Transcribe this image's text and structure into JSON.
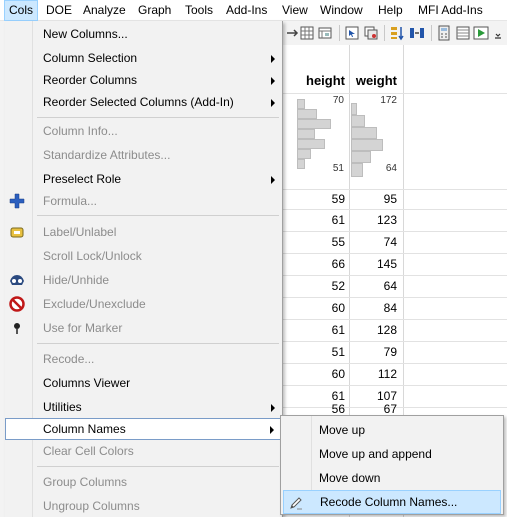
{
  "menubar": {
    "items": [
      "Cols",
      "DOE",
      "Analyze",
      "Graph",
      "Tools",
      "Add-Ins",
      "View",
      "Window",
      "Help",
      "MFI Add-Ins"
    ]
  },
  "cols_menu": {
    "items": [
      {
        "label": "New Columns...",
        "enabled": true,
        "submenu": false,
        "icon": null
      },
      {
        "label": "Column Selection",
        "enabled": true,
        "submenu": true,
        "icon": null
      },
      {
        "label": "Reorder Columns",
        "enabled": true,
        "submenu": true,
        "icon": null
      },
      {
        "label": "Reorder Selected Columns (Add-In)",
        "enabled": true,
        "submenu": true,
        "icon": null
      },
      {
        "label": "Column Info...",
        "enabled": false,
        "submenu": false,
        "icon": null
      },
      {
        "label": "Standardize Attributes...",
        "enabled": false,
        "submenu": false,
        "icon": null
      },
      {
        "label": "Preselect Role",
        "enabled": true,
        "submenu": true,
        "icon": null
      },
      {
        "label": "Formula...",
        "enabled": false,
        "submenu": false,
        "icon": "formula-plus-icon"
      },
      {
        "label": "Label/Unlabel",
        "enabled": false,
        "submenu": false,
        "icon": "label-tag-icon"
      },
      {
        "label": "Scroll Lock/Unlock",
        "enabled": false,
        "submenu": false,
        "icon": null
      },
      {
        "label": "Hide/Unhide",
        "enabled": false,
        "submenu": false,
        "icon": "hide-mask-icon"
      },
      {
        "label": "Exclude/Unexclude",
        "enabled": false,
        "submenu": false,
        "icon": "exclude-circle-icon"
      },
      {
        "label": "Use for Marker",
        "enabled": false,
        "submenu": false,
        "icon": "marker-pin-icon"
      },
      {
        "label": "Recode...",
        "enabled": false,
        "submenu": false,
        "icon": null
      },
      {
        "label": "Columns Viewer",
        "enabled": true,
        "submenu": false,
        "icon": null
      },
      {
        "label": "Utilities",
        "enabled": true,
        "submenu": true,
        "icon": null
      },
      {
        "label": "Column Names",
        "enabled": true,
        "submenu": true,
        "icon": null,
        "highlighted": true
      },
      {
        "label": "Clear Cell Colors",
        "enabled": false,
        "submenu": false,
        "icon": null
      },
      {
        "label": "Group Columns",
        "enabled": false,
        "submenu": false,
        "icon": null
      },
      {
        "label": "Ungroup Columns",
        "enabled": false,
        "submenu": false,
        "icon": null
      }
    ]
  },
  "column_names_submenu": {
    "items": [
      {
        "label": "Move up",
        "highlighted": false
      },
      {
        "label": "Move up and append",
        "highlighted": false
      },
      {
        "label": "Move down",
        "highlighted": false
      },
      {
        "label": "Recode Column Names...",
        "highlighted": true
      }
    ]
  },
  "table": {
    "headers": [
      "height",
      "weight"
    ],
    "histograms": {
      "height": {
        "max_label": "70",
        "min_label": "51"
      },
      "weight": {
        "max_label": "172",
        "min_label": "64"
      }
    },
    "rows": [
      [
        "59",
        "95"
      ],
      [
        "61",
        "123"
      ],
      [
        "55",
        "74"
      ],
      [
        "66",
        "145"
      ],
      [
        "52",
        "64"
      ],
      [
        "60",
        "84"
      ],
      [
        "61",
        "128"
      ],
      [
        "51",
        "79"
      ],
      [
        "60",
        "112"
      ],
      [
        "61",
        "107"
      ],
      [
        "56",
        "67"
      ]
    ]
  },
  "colors": {
    "menu_bg": "#f2f2f2",
    "highlight_bg": "#cce8ff",
    "highlight_border": "#99d1ff",
    "disabled_text": "#8c8c8c"
  }
}
